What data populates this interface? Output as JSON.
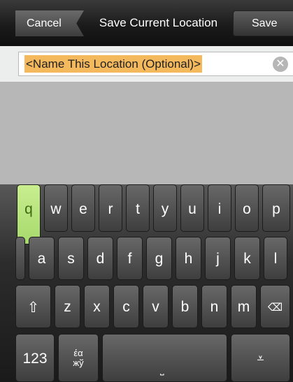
{
  "titlebar": {
    "cancel_label": "Cancel",
    "title": "Save Current Location",
    "save_label": "Save"
  },
  "field": {
    "placeholder": "<Name This Location (Optional)>",
    "clear_icon": "clear-icon"
  },
  "keyboard": {
    "row1": [
      "q",
      "w",
      "e",
      "r",
      "t",
      "y",
      "u",
      "i",
      "o",
      "p"
    ],
    "row2": [
      "a",
      "s",
      "d",
      "f",
      "g",
      "h",
      "j",
      "k",
      "l"
    ],
    "row3": [
      "z",
      "x",
      "c",
      "v",
      "b",
      "n",
      "m"
    ],
    "shift_icon": "shift-icon",
    "delete_icon": "delete-icon",
    "numbers_label": "123",
    "alt_chars": "έα жў",
    "space_icon": "space-icon",
    "hide_icon": "hide-keyboard-icon",
    "active_key": "q",
    "colors": {
      "active": "#b5e07b",
      "highlight": "#f4b85d"
    }
  }
}
